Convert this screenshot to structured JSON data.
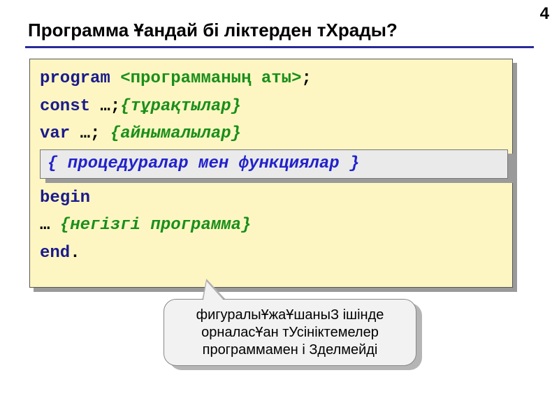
{
  "page_number": "4",
  "title": "Программа Ұандай бі ліктерден тХрады?",
  "code": {
    "l1_kw": "program",
    "l1_arg": "<программаның аты>",
    "l1_end": ";",
    "l2_kw": "const",
    "l2_mid": " …;",
    "l2_cm": "{тұрақтылар}",
    "l3_kw": "var",
    "l3_mid": " …; ",
    "l3_cm": "{айнымалылар}",
    "inset": "{ процедуралар мен функциялар }",
    "l5_kw": "begin",
    "l6_pre": " … ",
    "l6_cm": "{негізгі программа}",
    "l7_kw": "end",
    "l7_dot": "."
  },
  "callout": "фигуралыҰжаҰшаныЗ ішінде орналасҰан тУсініктемелер программамен і Зделмейді"
}
